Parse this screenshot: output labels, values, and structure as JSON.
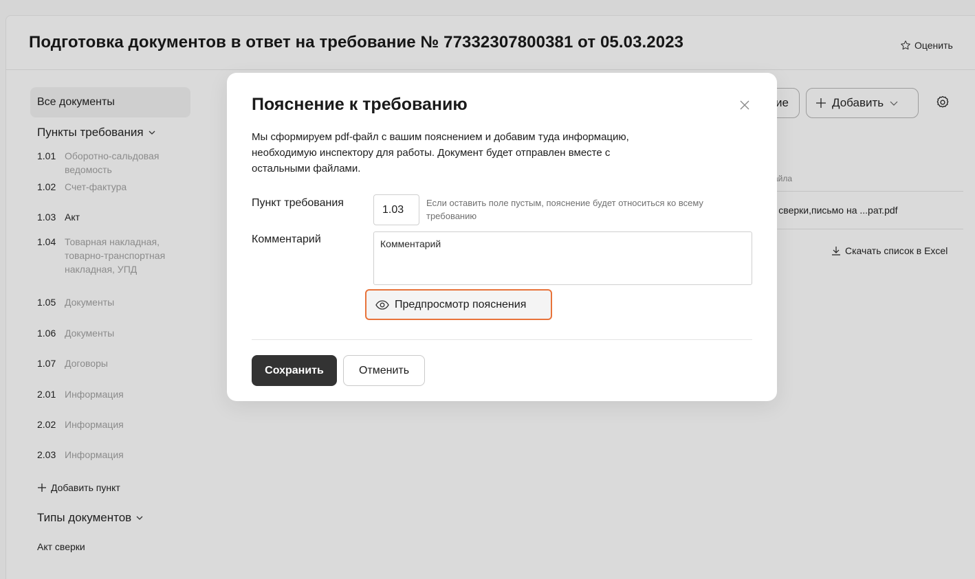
{
  "header": {
    "title": "Подготовка документов в ответ на требование № 77332307800381 от 05.03.2023",
    "rate_label": "Оценить"
  },
  "sidebar": {
    "all_documents": "Все документы",
    "requirement_points_label": "Пункты требования",
    "items": [
      {
        "num": "1.01",
        "label": "Оборотно-сальдовая ведомость"
      },
      {
        "num": "1.02",
        "label": "Счет-фактура"
      },
      {
        "num": "1.03",
        "label": "Акт"
      },
      {
        "num": "1.04",
        "label": "Товарная накладная, товарно-транспортная накладная, УПД"
      },
      {
        "num": "1.05",
        "label": "Документы"
      },
      {
        "num": "1.06",
        "label": "Документы"
      },
      {
        "num": "1.07",
        "label": "Договоры"
      },
      {
        "num": "2.01",
        "label": "Информация"
      },
      {
        "num": "2.02",
        "label": "Информация"
      },
      {
        "num": "2.03",
        "label": "Информация"
      }
    ],
    "add_point": "Добавить пункт",
    "doc_types_label": "Типы документов",
    "doc_type_first": "Акт сверки"
  },
  "background": {
    "partial_button": "ие",
    "add_button": "Добавить",
    "column_partial": "айла",
    "file_partial": "т сверки,письмо на ...рат.pdf",
    "download_excel": "Скачать список в Excel"
  },
  "modal": {
    "title": "Пояснение к требованию",
    "description": "Мы сформируем pdf-файл с вашим пояснением и добавим туда информацию, необходимую инспектору для работы. Документ будет отправлен вместе с остальными файлами.",
    "point_label": "Пункт требования",
    "point_value": "1.03",
    "point_hint": "Если оставить поле пустым, пояснение будет относиться ко всему требованию",
    "comment_label": "Комментарий",
    "comment_placeholder": "Комментарий",
    "preview_label": "Предпросмотр пояснения",
    "save_label": "Сохранить",
    "cancel_label": "Отменить"
  },
  "colors": {
    "overlay_background": "#d6d6d6",
    "preview_border": "#e8733a",
    "save_button": "#333333"
  }
}
